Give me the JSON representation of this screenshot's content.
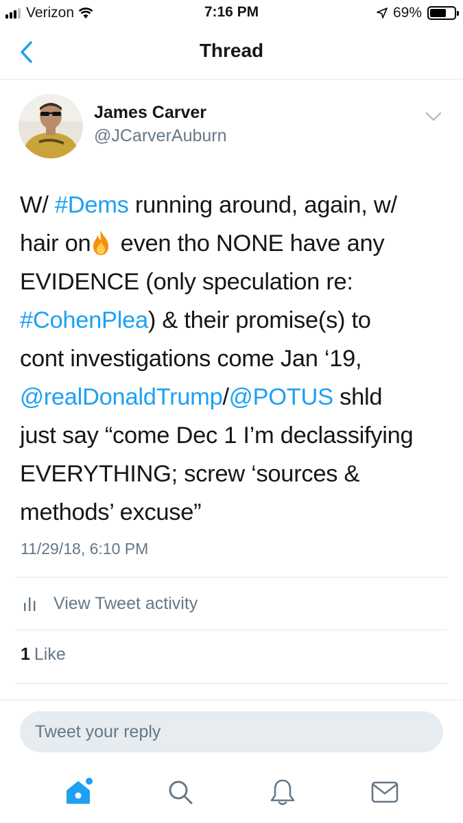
{
  "status_bar": {
    "carrier": "Verizon",
    "time": "7:16 PM",
    "battery": "69%",
    "battery_level": 0.69
  },
  "nav": {
    "title": "Thread",
    "back_icon": "chevron-left-icon"
  },
  "tweet": {
    "author_name": "James Carver",
    "author_handle": "@JCarverAuburn",
    "text_lines": [
      [
        "W/ ",
        "#Dems",
        " running around, again, w/"
      ],
      [
        "hair on",
        "🔥",
        " even tho NONE have any"
      ],
      [
        "EVIDENCE (only speculation re:"
      ],
      [
        "#CohenPlea",
        ") & their promise(s) to"
      ],
      [
        "cont investigations come Jan ‘19,"
      ],
      [
        "@realDonaldTrump",
        "/",
        "@POTUS",
        " shld"
      ],
      [
        "just say “come Dec 1 I’m declassifying"
      ],
      [
        "EVERYTHING; screw ‘sources &"
      ],
      [
        "methods’ excuse”"
      ]
    ],
    "timestamp": "11/29/18, 6:10 PM",
    "activity_label": "View Tweet activity",
    "likes_count": "1",
    "likes_label": "Like"
  },
  "compose": {
    "placeholder": "Tweet your reply"
  },
  "tab_bar": {
    "items": [
      {
        "icon": "home-icon",
        "active": true
      },
      {
        "icon": "search-icon",
        "active": false
      },
      {
        "icon": "bell-icon",
        "active": false
      },
      {
        "icon": "mail-icon",
        "active": false
      }
    ]
  },
  "colors": {
    "link": "#1da1f2",
    "secondary_text": "#657786",
    "primary_text": "#14171a",
    "divider": "#e1e8ed"
  }
}
